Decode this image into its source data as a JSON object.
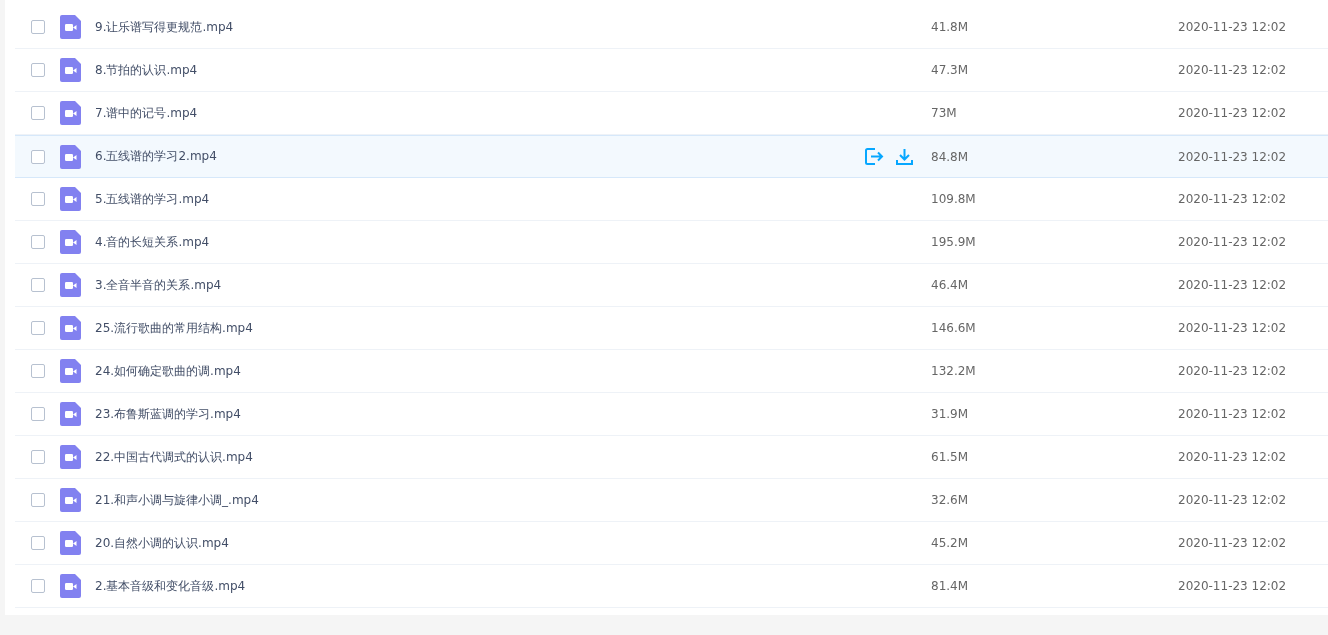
{
  "files": [
    {
      "name": "9.让乐谱写得更规范.mp4",
      "size": "41.8M",
      "modified": "2020-11-23 12:02",
      "checked": false,
      "highlighted": false
    },
    {
      "name": "8.节拍的认识.mp4",
      "size": "47.3M",
      "modified": "2020-11-23 12:02",
      "checked": false,
      "highlighted": false
    },
    {
      "name": "7.谱中的记号.mp4",
      "size": "73M",
      "modified": "2020-11-23 12:02",
      "checked": false,
      "highlighted": false
    },
    {
      "name": "6.五线谱的学习2.mp4",
      "size": "84.8M",
      "modified": "2020-11-23 12:02",
      "checked": false,
      "highlighted": true
    },
    {
      "name": "5.五线谱的学习.mp4",
      "size": "109.8M",
      "modified": "2020-11-23 12:02",
      "checked": false,
      "highlighted": false
    },
    {
      "name": "4.音的长短关系.mp4",
      "size": "195.9M",
      "modified": "2020-11-23 12:02",
      "checked": false,
      "highlighted": false
    },
    {
      "name": "3.全音半音的关系.mp4",
      "size": "46.4M",
      "modified": "2020-11-23 12:02",
      "checked": false,
      "highlighted": false
    },
    {
      "name": "25.流行歌曲的常用结构.mp4",
      "size": "146.6M",
      "modified": "2020-11-23 12:02",
      "checked": false,
      "highlighted": false
    },
    {
      "name": "24.如何确定歌曲的调.mp4",
      "size": "132.2M",
      "modified": "2020-11-23 12:02",
      "checked": false,
      "highlighted": false
    },
    {
      "name": "23.布鲁斯蓝调的学习.mp4",
      "size": "31.9M",
      "modified": "2020-11-23 12:02",
      "checked": false,
      "highlighted": false
    },
    {
      "name": "22.中国古代调式的认识.mp4",
      "size": "61.5M",
      "modified": "2020-11-23 12:02",
      "checked": false,
      "highlighted": false
    },
    {
      "name": "21.和声小调与旋律小调_.mp4",
      "size": "32.6M",
      "modified": "2020-11-23 12:02",
      "checked": false,
      "highlighted": false
    },
    {
      "name": "20.自然小调的认识.mp4",
      "size": "45.2M",
      "modified": "2020-11-23 12:02",
      "checked": false,
      "highlighted": false
    },
    {
      "name": "2.基本音级和变化音级.mp4",
      "size": "81.4M",
      "modified": "2020-11-23 12:02",
      "checked": false,
      "highlighted": false
    }
  ]
}
